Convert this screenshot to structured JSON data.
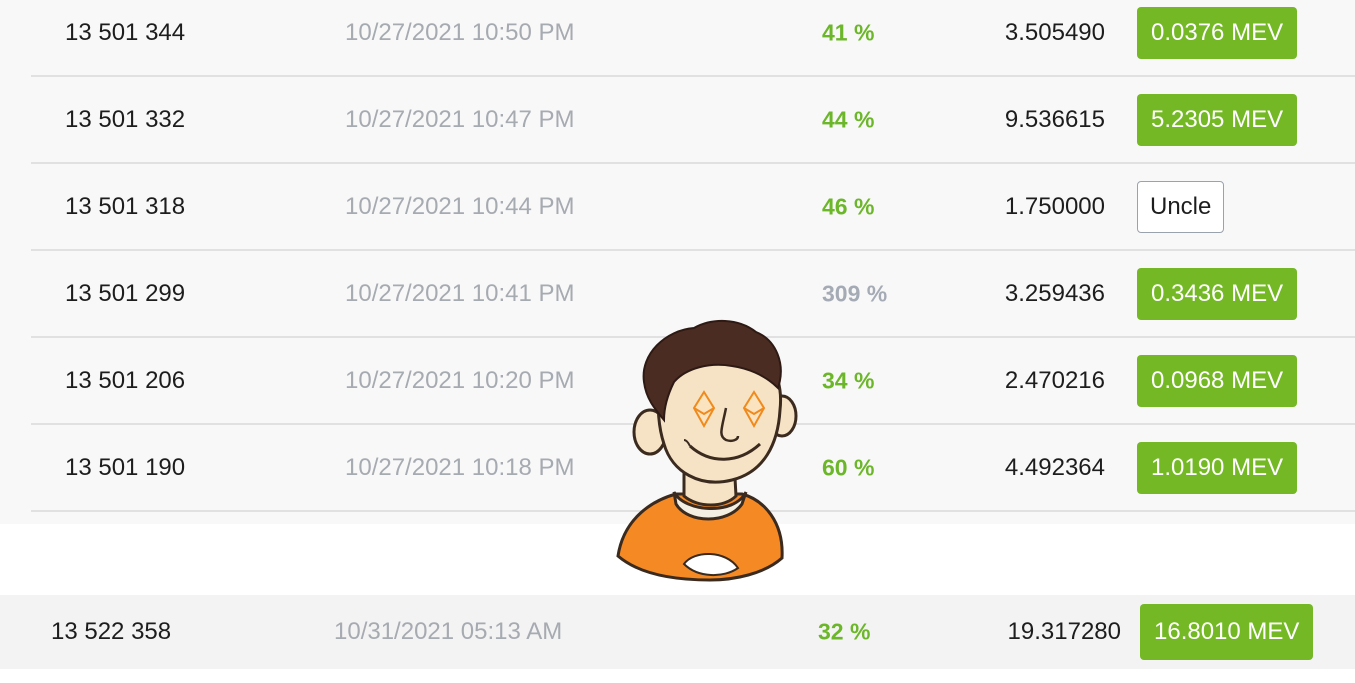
{
  "rows": [
    {
      "block": "13 501 344",
      "time": "10/27/2021 10:50 PM",
      "percent": "41 %",
      "percent_style": "green",
      "reward": "3.505490",
      "badge": "0.0376 MEV",
      "badge_type": "mev"
    },
    {
      "block": "13 501 332",
      "time": "10/27/2021 10:47 PM",
      "percent": "44 %",
      "percent_style": "green",
      "reward": "9.536615",
      "badge": "5.2305 MEV",
      "badge_type": "mev"
    },
    {
      "block": "13 501 318",
      "time": "10/27/2021 10:44 PM",
      "percent": "46 %",
      "percent_style": "green",
      "reward": "1.750000",
      "badge": "Uncle",
      "badge_type": "uncle"
    },
    {
      "block": "13 501 299",
      "time": "10/27/2021 10:41 PM",
      "percent": "309 %",
      "percent_style": "gray",
      "reward": "3.259436",
      "badge": "0.3436 MEV",
      "badge_type": "mev"
    },
    {
      "block": "13 501 206",
      "time": "10/27/2021 10:20 PM",
      "percent": "34 %",
      "percent_style": "green",
      "reward": "2.470216",
      "badge": "0.0968 MEV",
      "badge_type": "mev"
    },
    {
      "block": "13 501 190",
      "time": "10/27/2021 10:18 PM",
      "percent": "60 %",
      "percent_style": "green",
      "reward": "4.492364",
      "badge": "1.0190 MEV",
      "badge_type": "mev"
    }
  ],
  "highlight_row": {
    "block": "13 522 358",
    "time": "10/31/2021 05:13 AM",
    "percent": "32 %",
    "reward": "19.317280",
    "badge": "16.8010 MEV"
  },
  "mascot": {
    "icon": "cartoon-man-with-ethereum-eyes",
    "shirt_color": "#f58a24"
  },
  "colors": {
    "accent_green": "#74b925",
    "percent_green": "#6cb62a",
    "muted_gray": "#a6aab1"
  }
}
